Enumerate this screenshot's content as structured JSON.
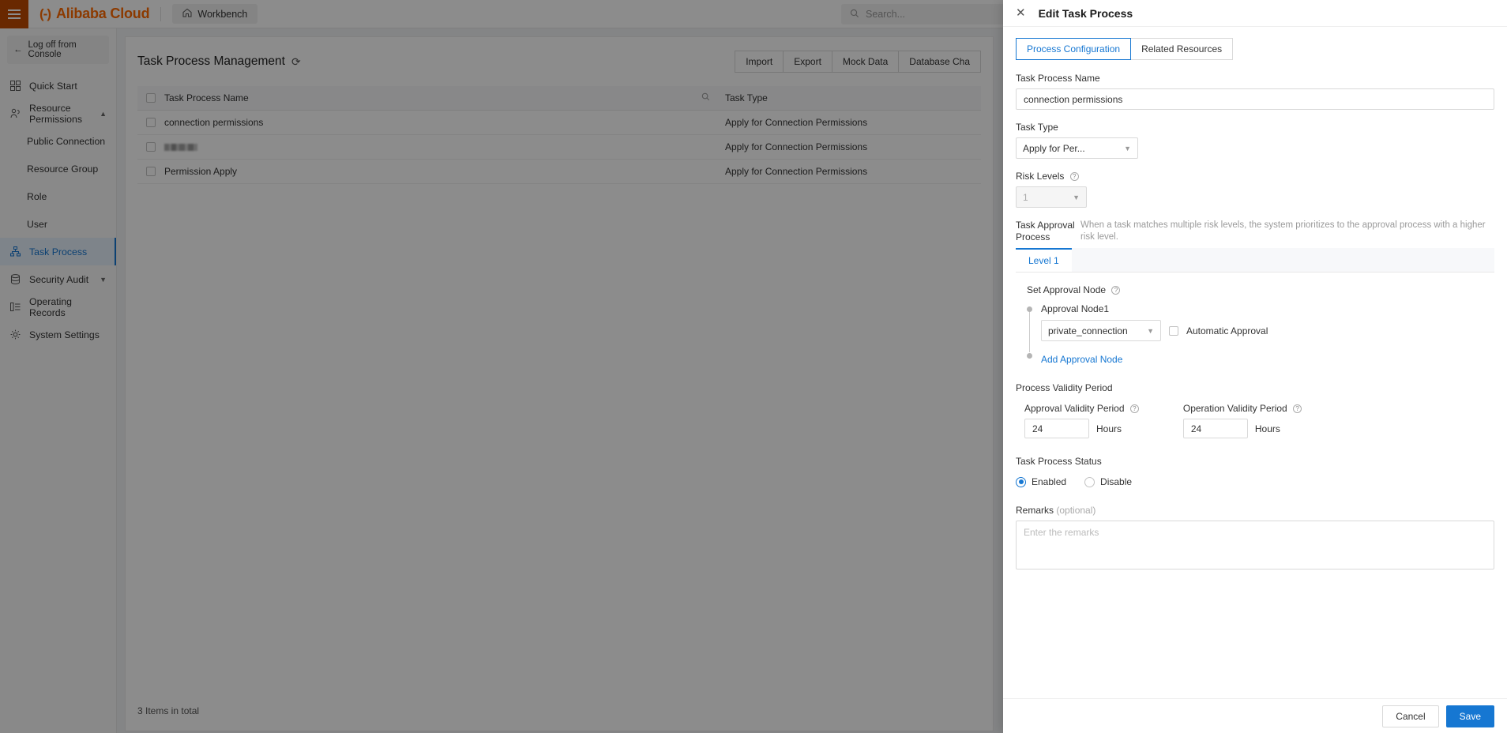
{
  "topbar": {
    "brand": "Alibaba Cloud",
    "brand_mark": "(-)",
    "workbench": "Workbench",
    "search_placeholder": "Search..."
  },
  "sidebar": {
    "logoff": "Log off from Console",
    "items": [
      {
        "label": "Quick Start",
        "icon": "grid-icon",
        "level": 0,
        "active": false,
        "chevron": ""
      },
      {
        "label": "Resource Permissions",
        "icon": "users-icon",
        "level": 0,
        "active": false,
        "chevron": "▲"
      },
      {
        "label": "Public Connection",
        "icon": "",
        "level": 1,
        "active": false,
        "chevron": ""
      },
      {
        "label": "Resource Group",
        "icon": "",
        "level": 1,
        "active": false,
        "chevron": ""
      },
      {
        "label": "Role",
        "icon": "",
        "level": 1,
        "active": false,
        "chevron": ""
      },
      {
        "label": "User",
        "icon": "",
        "level": 1,
        "active": false,
        "chevron": ""
      },
      {
        "label": "Task Process",
        "icon": "sitemap-icon",
        "level": 0,
        "active": true,
        "chevron": ""
      },
      {
        "label": "Security Audit",
        "icon": "database-icon",
        "level": 0,
        "active": false,
        "chevron": "▼"
      },
      {
        "label": "Operating Records",
        "icon": "list-icon",
        "level": 0,
        "active": false,
        "chevron": ""
      },
      {
        "label": "System Settings",
        "icon": "gear-icon",
        "level": 0,
        "active": false,
        "chevron": ""
      }
    ]
  },
  "page": {
    "title": "Task Process Management",
    "toolbar_buttons": [
      "Import",
      "Export",
      "Mock Data",
      "Database Cha"
    ],
    "total_text": "3 Items in total"
  },
  "table": {
    "columns": [
      "Task Process Name",
      "Task Type"
    ],
    "rows": [
      {
        "name": "connection permissions",
        "redacted": false,
        "type": "Apply for Connection Permissions"
      },
      {
        "name": "",
        "redacted": true,
        "type": "Apply for Connection Permissions"
      },
      {
        "name": "Permission Apply",
        "redacted": false,
        "type": "Apply for Connection Permissions"
      }
    ]
  },
  "drawer": {
    "title": "Edit Task Process",
    "close_label": "✕",
    "tabs": [
      {
        "label": "Process Configuration",
        "active": true
      },
      {
        "label": "Related Resources",
        "active": false
      }
    ],
    "task_process_name": {
      "label": "Task Process Name",
      "value": "connection permissions"
    },
    "task_type": {
      "label": "Task Type",
      "value": "Apply for Per..."
    },
    "risk_levels": {
      "label": "Risk Levels",
      "value": "1",
      "disabled": true
    },
    "task_approval_process": {
      "label_line1": "Task Approval",
      "label_line2": "Process",
      "description": "When a task matches multiple risk levels, the system prioritizes to the approval process with a higher risk level.",
      "level_tabs": [
        "Level 1"
      ],
      "set_approval_node_label": "Set Approval Node",
      "nodes": [
        {
          "name": "Approval Node1",
          "value": "private_connection",
          "automatic_approval_label": "Automatic Approval",
          "automatic_approval_checked": false
        }
      ],
      "add_node_label": "Add Approval Node"
    },
    "process_validity_period": {
      "title": "Process Validity Period",
      "approval": {
        "label": "Approval Validity Period",
        "value": "24",
        "unit": "Hours"
      },
      "operation": {
        "label": "Operation Validity Period",
        "value": "24",
        "unit": "Hours"
      }
    },
    "task_process_status": {
      "title": "Task Process Status",
      "options": [
        {
          "label": "Enabled",
          "selected": true
        },
        {
          "label": "Disable",
          "selected": false
        }
      ]
    },
    "remarks": {
      "label": "Remarks",
      "optional": "(optional)",
      "placeholder": "Enter the remarks",
      "value": ""
    },
    "footer": {
      "cancel": "Cancel",
      "save": "Save"
    }
  },
  "colors": {
    "brand_orange": "#ff6a00",
    "accent_blue": "#1677d2",
    "hamburger_bg": "#c04900"
  }
}
